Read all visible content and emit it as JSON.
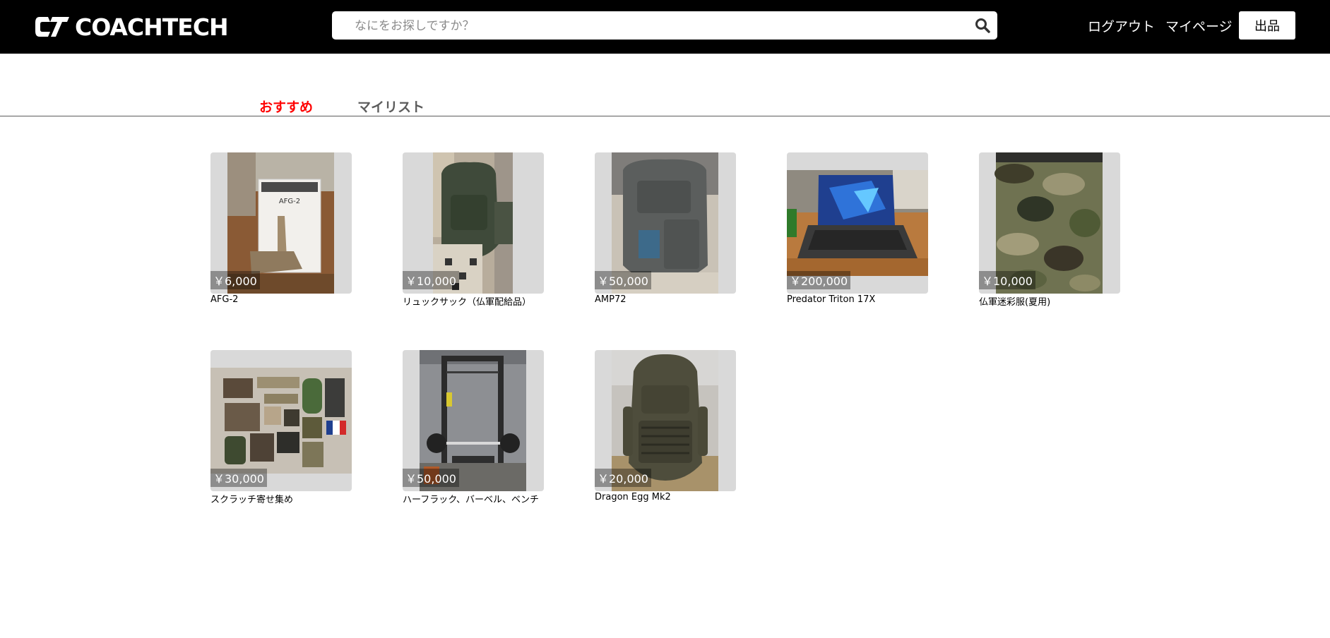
{
  "header": {
    "logo_text": "COACHTECH",
    "search_placeholder": "なにをお探しですか？",
    "logout_label": "ログアウト",
    "mypage_label": "マイページ",
    "sell_label": "出品"
  },
  "tabs": [
    {
      "label": "おすすめ",
      "active": true
    },
    {
      "label": "マイリスト",
      "active": false
    }
  ],
  "items": [
    {
      "price": "￥6,000",
      "name": "AFG-2",
      "photo": "grip"
    },
    {
      "price": "￥10,000",
      "name": "リュックサック（仏軍配給品）",
      "photo": "backpack-green"
    },
    {
      "price": "￥50,000",
      "name": "AMP72",
      "photo": "backpack-gray"
    },
    {
      "price": "￥200,000",
      "name": "Predator Triton 17X",
      "photo": "laptop"
    },
    {
      "price": "￥10,000",
      "name": "仏軍迷彩服(夏用)",
      "photo": "camo-jacket"
    },
    {
      "price": "￥30,000",
      "name": "スクラッチ寄せ集め",
      "photo": "patches"
    },
    {
      "price": "￥50,000",
      "name": "ハーフラック、バーベル、ベンチ",
      "photo": "rack"
    },
    {
      "price": "￥20,000",
      "name": "Dragon Egg Mk2",
      "photo": "backpack-olive"
    }
  ],
  "colors": {
    "header_bg": "#000000",
    "active_tab": "#ff0000",
    "inactive_tab": "#5c5c5c",
    "thumb_bg": "#d9d9d9"
  },
  "icons": {
    "search": "search-icon",
    "logo": "ct-logo-mark"
  }
}
